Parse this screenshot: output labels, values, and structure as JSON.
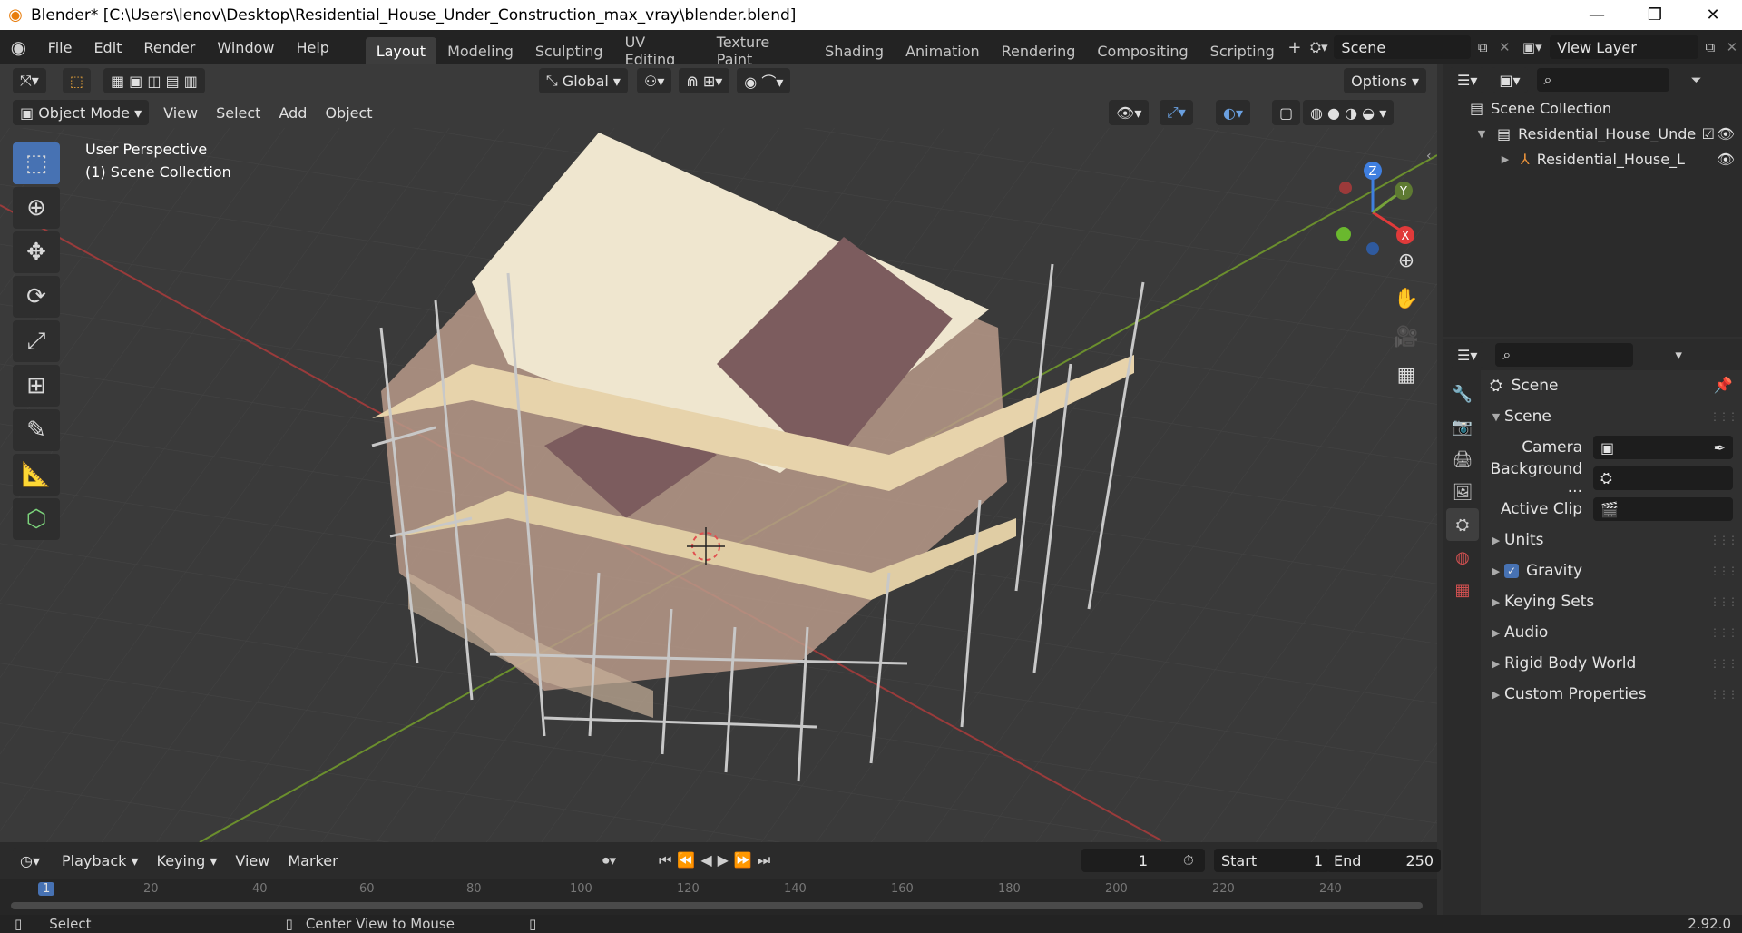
{
  "window": {
    "title": "Blender* [C:\\Users\\lenov\\Desktop\\Residential_House_Under_Construction_max_vray\\blender.blend]",
    "minimize": "—",
    "restore": "❐",
    "close": "✕"
  },
  "menu": {
    "items": [
      "File",
      "Edit",
      "Render",
      "Window",
      "Help"
    ]
  },
  "workspaces": {
    "tabs": [
      "Layout",
      "Modeling",
      "Sculpting",
      "UV Editing",
      "Texture Paint",
      "Shading",
      "Animation",
      "Rendering",
      "Compositing",
      "Scripting"
    ],
    "active": "Layout",
    "add": "+"
  },
  "scene_selector": {
    "value": "Scene"
  },
  "view_layer_selector": {
    "value": "View Layer"
  },
  "viewport": {
    "transform_orientation": "Global",
    "options_label": "Options",
    "mode": "Object Mode",
    "header_menus": [
      "View",
      "Select",
      "Add",
      "Object"
    ],
    "overlay_line1": "User Perspective",
    "overlay_line2": "(1) Scene Collection",
    "gizmo": {
      "z": "Z",
      "y": "Y",
      "x": "X"
    }
  },
  "outliner": {
    "root": "Scene Collection",
    "collection": "Residential_House_Unde",
    "object": "Residential_House_L"
  },
  "properties": {
    "header": "Scene",
    "panel": "Scene",
    "fields": [
      {
        "label": "Camera"
      },
      {
        "label": "Background ..."
      },
      {
        "label": "Active Clip"
      }
    ],
    "subpanels": [
      "Units",
      "Gravity",
      "Keying Sets",
      "Audio",
      "Rigid Body World",
      "Custom Properties"
    ],
    "gravity_checked": true
  },
  "timeline": {
    "menus": [
      "Playback",
      "Keying",
      "View",
      "Marker"
    ],
    "current_frame": "1",
    "start_label": "Start",
    "start_value": "1",
    "end_label": "End",
    "end_value": "250",
    "ruler": [
      "1",
      "20",
      "40",
      "60",
      "80",
      "100",
      "120",
      "140",
      "160",
      "180",
      "200",
      "220",
      "240"
    ]
  },
  "statusbar": {
    "select": "Select",
    "center_view": "Center View to Mouse",
    "version": "2.92.0"
  }
}
